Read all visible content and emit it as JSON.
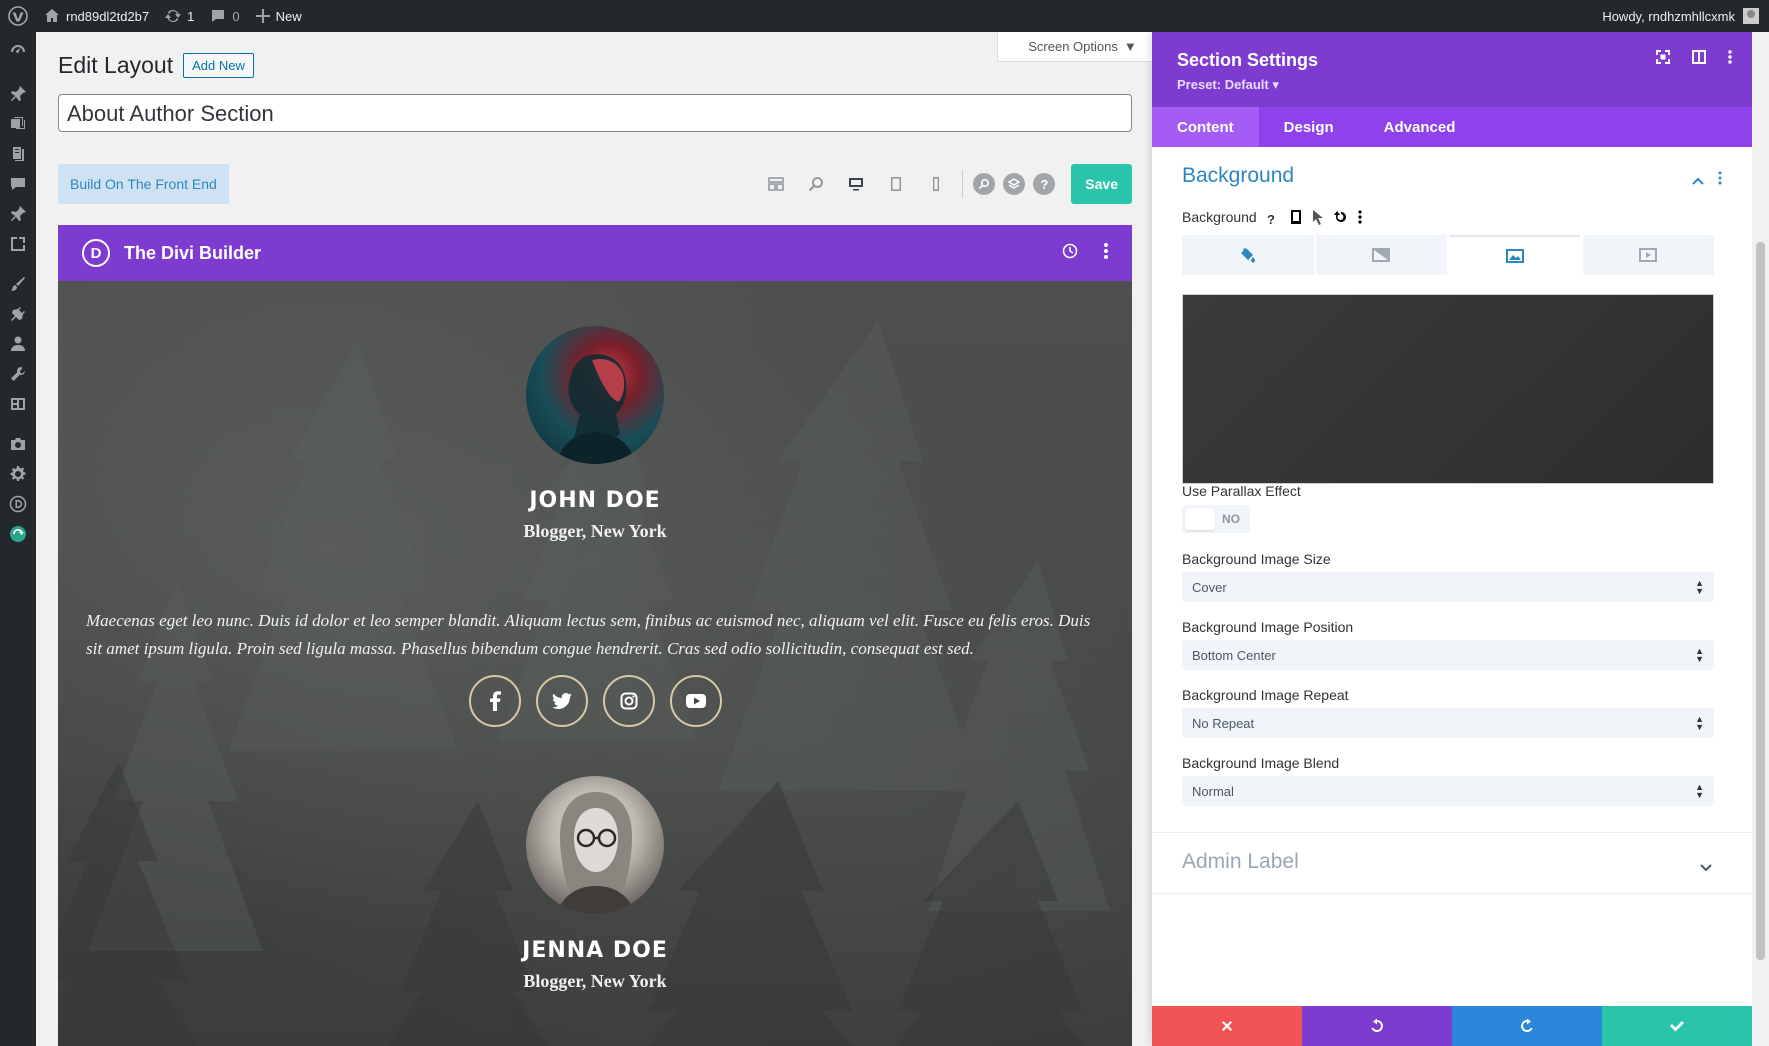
{
  "adminbar": {
    "site_name": "rnd89dl2td2b7",
    "updates_count": "1",
    "comments_count": "0",
    "new_label": "New",
    "howdy": "Howdy, rndhzmhllcxmk"
  },
  "screen_options": "Screen Options",
  "page": {
    "title": "Edit Layout",
    "add_new": "Add New",
    "post_title": "About Author Section"
  },
  "toolbar": {
    "build_front_end": "Build On The Front End",
    "help": "?",
    "save": "Save"
  },
  "builder": {
    "logo": "D",
    "name": "The Divi Builder"
  },
  "authors": [
    {
      "name": "JOHN DOE",
      "role": "Blogger, New York",
      "bio": "Maecenas eget leo nunc. Duis id dolor et leo semper blandit. Aliquam lectus sem, finibus ac euismod nec, aliquam vel elit. Fusce eu felis eros. Duis sit amet ipsum ligula. Proin sed ligula massa. Phasellus bibendum congue hendrerit. Cras sed odio sollicitudin, consequat est sed.",
      "socials": [
        "f",
        "twitter",
        "instagram",
        "youtube"
      ]
    },
    {
      "name": "JENNA DOE",
      "role": "Blogger, New York"
    }
  ],
  "panel": {
    "title": "Section Settings",
    "preset": "Preset: Default ▾",
    "tabs": [
      "Content",
      "Design",
      "Advanced"
    ],
    "background_section": "Background",
    "background_label": "Background",
    "parallax_label": "Use Parallax Effect",
    "parallax_value": "NO",
    "image_size_label": "Background Image Size",
    "image_size_value": "Cover",
    "image_position_label": "Background Image Position",
    "image_position_value": "Bottom Center",
    "image_repeat_label": "Background Image Repeat",
    "image_repeat_value": "No Repeat",
    "image_blend_label": "Background Image Blend",
    "image_blend_value": "Normal",
    "admin_label": "Admin Label"
  },
  "colors": {
    "divi_purple": "#7e3bd0",
    "save_green": "#29c4a9",
    "cancel_red": "#ef5555",
    "redo_blue": "#2b87da"
  }
}
